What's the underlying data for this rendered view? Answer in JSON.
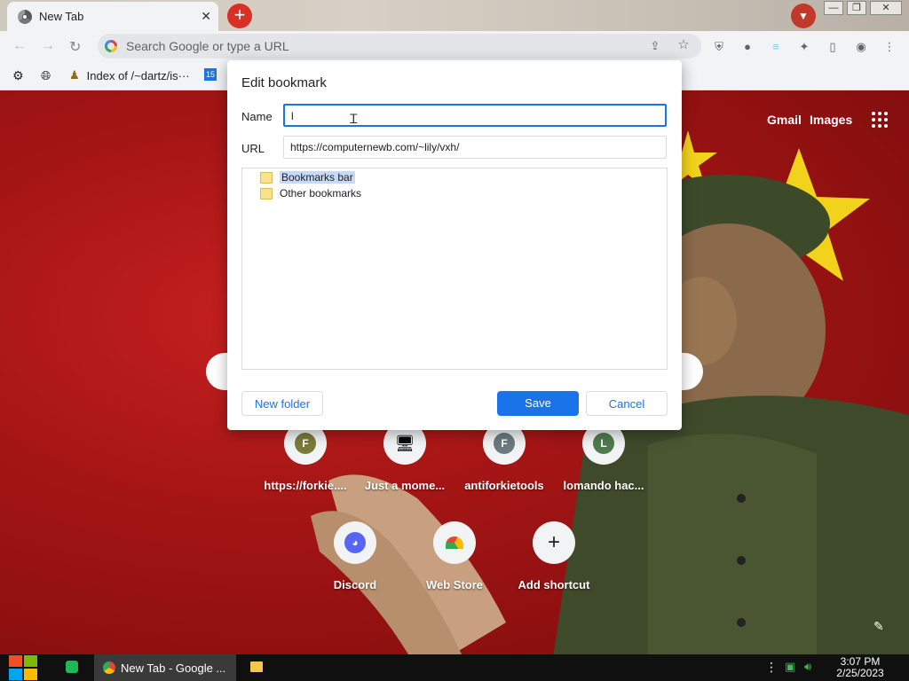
{
  "browser": {
    "tab_title": "New Tab",
    "tab_close": "✕",
    "new_tab": "+",
    "omnibox_placeholder": "Search Google or type a URL",
    "window_controls": [
      "—",
      "❐",
      "✕"
    ]
  },
  "bookmarks_bar": {
    "items": [
      {
        "label": "",
        "icon": "app-icon"
      },
      {
        "label": "",
        "icon": "globe-icon"
      },
      {
        "label": "Index of /~dartz/is···",
        "icon": "person-icon"
      },
      {
        "label": "",
        "icon": "app-blue-icon"
      }
    ]
  },
  "newtab": {
    "header_links": [
      "Gmail",
      "Images"
    ],
    "shortcuts": [
      {
        "label": "https://forkie....",
        "letter": "F",
        "color": "#7a7a3a"
      },
      {
        "label": "Just a mome...",
        "letter": "",
        "color": ""
      },
      {
        "label": "antiforkietools",
        "letter": "F",
        "color": "#6b7a80"
      },
      {
        "label": "lomando hac...",
        "letter": "L",
        "color": "#4f7a4f"
      },
      {
        "label": "Discord",
        "letter": "",
        "color": "#5865f2"
      },
      {
        "label": "Web Store",
        "letter": "",
        "color": ""
      },
      {
        "label": "Add shortcut",
        "letter": "+",
        "color": ""
      }
    ]
  },
  "dialog": {
    "title": "Edit bookmark",
    "name_label": "Name",
    "name_value": "l",
    "url_label": "URL",
    "url_value": "https://computernewb.com/~lily/vxh/",
    "folders": [
      "Bookmarks bar",
      "Other bookmarks"
    ],
    "selected_folder": "Bookmarks bar",
    "new_folder_label": "New folder",
    "save_label": "Save",
    "cancel_label": "Cancel"
  },
  "taskbar": {
    "task_label": "New Tab - Google ...",
    "time": "3:07 PM",
    "date": "2/25/2023"
  }
}
